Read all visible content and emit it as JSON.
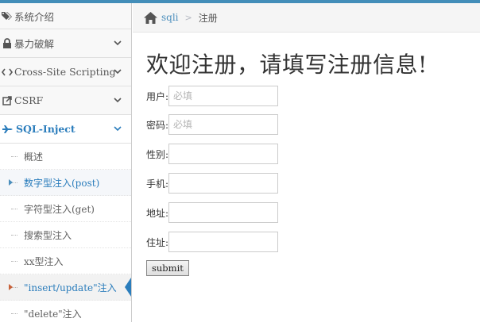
{
  "sidebar": {
    "items": [
      {
        "label": "系统介绍",
        "icon": "tags-icon"
      },
      {
        "label": "暴力破解",
        "icon": "lock-icon"
      },
      {
        "label": "Cross-Site Scripting",
        "icon": "code-icon"
      },
      {
        "label": "CSRF",
        "icon": "share-icon"
      },
      {
        "label": "SQL-Inject",
        "icon": "fighter-jet-icon"
      }
    ],
    "sub_items": [
      {
        "label": "概述"
      },
      {
        "label": "数字型注入(post)"
      },
      {
        "label": "字符型注入(get)"
      },
      {
        "label": "搜索型注入"
      },
      {
        "label": "xx型注入"
      },
      {
        "label": "\"insert/update\"注入"
      },
      {
        "label": "\"delete\"注入"
      }
    ]
  },
  "breadcrumb": {
    "home": "sqli",
    "separator": ">",
    "current": "注册"
  },
  "form": {
    "title": "欢迎注册，请填写注册信息!",
    "fields": [
      {
        "label": "用户:",
        "placeholder": "必填"
      },
      {
        "label": "密码:",
        "placeholder": "必填"
      },
      {
        "label": "性别:",
        "placeholder": ""
      },
      {
        "label": "手机:",
        "placeholder": ""
      },
      {
        "label": "地址:",
        "placeholder": ""
      },
      {
        "label": "住址:",
        "placeholder": ""
      }
    ],
    "submit_label": "submit"
  },
  "colors": {
    "accent": "#438eb9",
    "active_text": "#2b7dbc",
    "current_marker": "#c86139"
  }
}
